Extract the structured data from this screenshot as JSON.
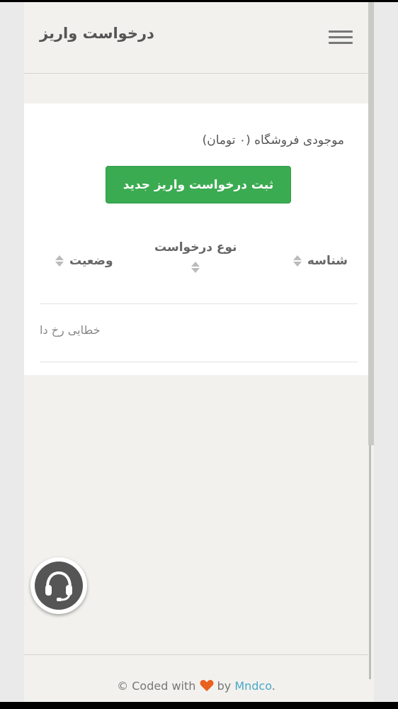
{
  "header": {
    "title": "درخواست واریز",
    "menu_icon": "hamburger-menu-icon"
  },
  "card": {
    "balance_text": "موجودی فروشگاه (۰ تومان)",
    "new_request_label": "ثبت درخواست واریز جدید",
    "primary_color": "#3bab52",
    "table": {
      "columns": [
        "شناسه",
        "نوع درخواست",
        "وضعیت"
      ],
      "sort_icon": "sort-arrows-icon",
      "error_message": "خطایی رخ دا"
    }
  },
  "support": {
    "icon": "headset-icon"
  },
  "footer": {
    "prefix": "© Coded with",
    "heart_icon": "heart-icon",
    "by": "by",
    "link": "Mndco",
    "suffix": ".",
    "link_color": "#4aa8c9",
    "heart_color": "#e8601c"
  }
}
